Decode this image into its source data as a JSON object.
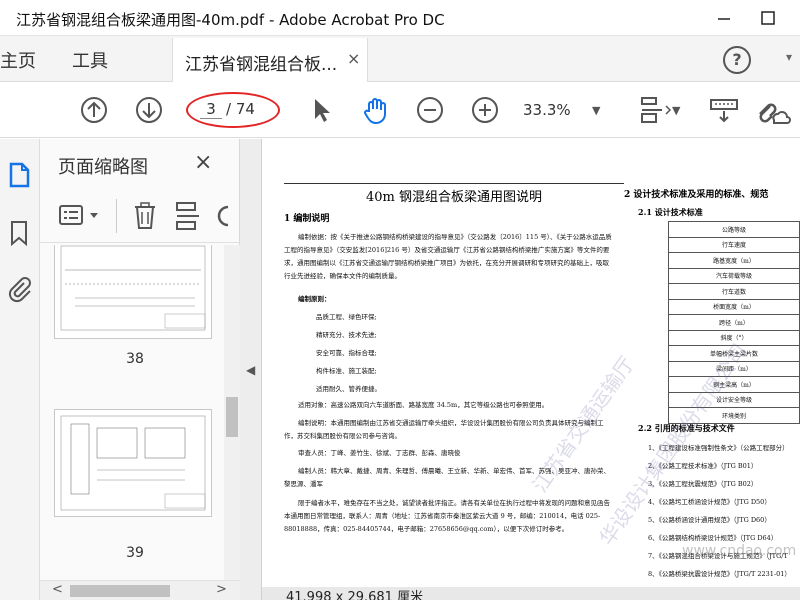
{
  "window": {
    "title": "江苏省钢混组合板梁通用图-40m.pdf - Adobe Acrobat Pro DC",
    "minimize_icon": "minimize-icon",
    "maximize_icon": "maximize-icon"
  },
  "menu": {
    "home": "主页",
    "tools": "工具"
  },
  "tab": {
    "label": "江苏省钢混组合板...",
    "close": "×"
  },
  "toolbar": {
    "page_current": "3",
    "page_total": "/ 74",
    "zoom": "33.3%",
    "highlight_color": "#e32424"
  },
  "panel": {
    "title": "页面缩略图",
    "close": "×",
    "thumbnails": [
      {
        "label": "38"
      },
      {
        "label": "39"
      }
    ]
  },
  "document": {
    "title": "40m 钢混组合板梁通用图说明",
    "sec1": "1 编制说明",
    "p1": "编制依据：按《关于推进公路钢结构桥梁建设的指导意见》（交公路发〔2016〕115 号）、《关于公路水运品质工程的指导意见》（交安监发[2016]216 号）及省交通运输厅《江苏省公路钢结构桥梁推广实施方案》等文件的要求，通用图编制以《江苏省交通运输厅钢结构桥梁推广项目》为依托，在充分开展调研和专项研究的基础上，吸取行业先进经验，确保本文件的编制质量。",
    "principles_head": "编制原则：",
    "principles": [
      "品质工程、绿色环保;",
      "精研充分、技术先进;",
      "安全可靠、指标合理;",
      "构件标准、施工装配;",
      "适用耐久、管养便捷。"
    ],
    "p_target": "适用对象：高速公路双向六车道断面、路基宽度 34.5m，其它等级公路也可参照使用。",
    "p_unit": "编制说明：本通用图编制由江苏省交通运输厅牵头组织，华设设计集团股份有限公司负责具体研究与编制工作，苏交科集团股份有限公司参与咨询。",
    "p_review": "审查人员：丁峰、姜竹生、徐斌、丁志群、彭森、唐晓俊",
    "p_authors": "编制人员：韩大章、戴捷、周青、朱理哲、傅晨曦、王立新、华新、单宏伟、首军、苏强、吴亚冲、唐孙荣、黎思源、潘军",
    "p_note": "限于编者水平，难免存在不当之处，诚望读者批评指正。请各有关单位在执行过程中将发现的问题和意见函告本通用图日常管理组，联系人：周青（地址：江苏省南京市秦淮区紫云大道 9 号，邮编：210014，电话 025-88018888，传真：025-84405744，电子邮箱：27658656@qq.com），以便下次修订时参考。",
    "sec2": "2 设计技术标准及采用的标准、规范",
    "sec21": "2.1 设计技术标准",
    "table_rows": [
      "公路等级",
      "行车速度",
      "路基宽度（m）",
      "汽车荷载等级",
      "行车道数",
      "桥面宽度（m）",
      "跨径（m）",
      "斜度（°）",
      "单幅桥梁主梁片数",
      "梁间距（m）",
      "钢主梁高（m）",
      "设计安全等级",
      "环境类别"
    ],
    "sec22": "2.2 引用的标准与技术文件",
    "refs": [
      "1、《工程建设标准强制性条文》（公路工程部分）",
      "2、《公路工程技术标准》（JTG B01）",
      "3、《公路工程抗震规范》（JTG B02）",
      "4、《公路圬工桥涵设计规范》（JTG D50）",
      "5、《公路桥涵设计通用规范》（JTG D60）",
      "6、《公路钢结构桥梁设计规范》（JTG D64）",
      "7、《公路钢混组合桥梁设计与施工规范》（JTG/T",
      "8、《公路桥梁抗震设计规范》（JTG/T 2231-01）"
    ],
    "watermark1": "江苏省交通运输厅",
    "watermark2": "华设设计集团股份有限公司",
    "site_mark": "www.cndao.com",
    "page_size": "41.998 x 29.681 厘米"
  }
}
